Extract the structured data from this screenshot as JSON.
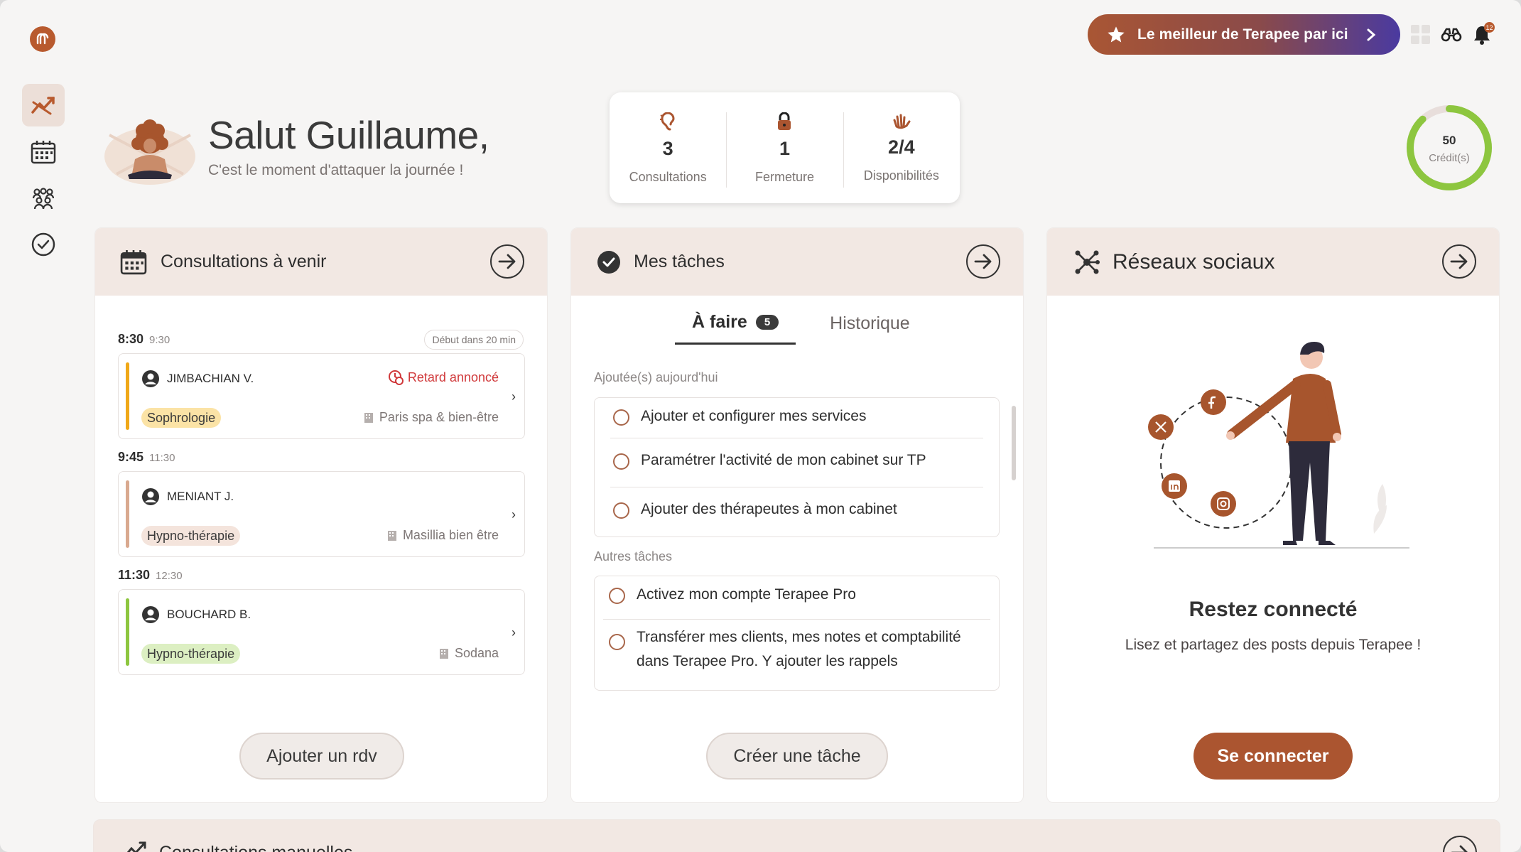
{
  "topbar": {
    "promo_label": "Le meilleur de Terapee par ici",
    "notification_count": "12",
    "icons": [
      "grid-icon",
      "binoculars-icon",
      "bell-icon"
    ]
  },
  "sidebar": {
    "items": [
      {
        "name": "dashboard",
        "icon": "chart-icon",
        "active": true
      },
      {
        "name": "calendar",
        "icon": "calendar-icon",
        "active": false
      },
      {
        "name": "clients",
        "icon": "people-icon",
        "active": false
      },
      {
        "name": "tasks",
        "icon": "check-circle-icon",
        "active": false
      }
    ]
  },
  "greeting": {
    "title": "Salut Guillaume,",
    "subtitle": "C'est le moment d'attaquer la journée !"
  },
  "stats": [
    {
      "value": "3",
      "label": "Consultations",
      "icon": "ear-icon"
    },
    {
      "value": "1",
      "label": "Fermeture",
      "icon": "lock-icon"
    },
    {
      "value": "2/4",
      "label": "Disponibilités",
      "icon": "hand-icon"
    }
  ],
  "credits": {
    "value": "50",
    "label": "Crédit(s)",
    "fraction": 0.88
  },
  "appointments_card": {
    "title": "Consultations à venir",
    "soon_badge": "Début dans 20 min",
    "button": "Ajouter un rdv",
    "items": [
      {
        "start": "8:30",
        "end": "9:30",
        "client": "JIMBACHIAN V.",
        "tag": "Sophrologie",
        "place": "Paris spa & bien-être",
        "alert": "Retard annoncé",
        "bar_color": "#f0a818",
        "tag_bg": "#fbe3a6"
      },
      {
        "start": "9:45",
        "end": "11:30",
        "client": "MENIANT J.",
        "tag": "Hypno-thérapie",
        "place": "Masillia bien être",
        "bar_color": "#d9a98f",
        "tag_bg": "#f4e4dc"
      },
      {
        "start": "11:30",
        "end": "12:30",
        "client": "BOUCHARD B.",
        "tag": "Hypno-thérapie",
        "place": "Sodana",
        "bar_color": "#8dc63f",
        "tag_bg": "#dcefc2"
      }
    ]
  },
  "tasks_card": {
    "title": "Mes tâches",
    "tab_todo": "À faire",
    "tab_todo_count": "5",
    "tab_history": "Historique",
    "group_today": "Ajoutée(s) aujourd'hui",
    "group_other": "Autres tâches",
    "today": [
      "Ajouter et configurer mes services",
      "Paramétrer l'activité de mon cabinet sur TP",
      "Ajouter des thérapeutes à mon cabinet"
    ],
    "other": [
      "Activez mon compte Terapee Pro",
      "Transférer mes clients, mes notes et comptabilité dans Terapee Pro. Y ajouter les rappels"
    ],
    "button": "Créer une tâche"
  },
  "social_card": {
    "title": "Réseaux sociaux",
    "heading": "Restez connecté",
    "text": "Lisez et partagez des posts depuis Terapee !",
    "button": "Se connecter",
    "networks": [
      "x-icon",
      "facebook-icon",
      "linkedin-icon",
      "instagram-icon"
    ]
  },
  "bottom_card": {
    "title": "Consultations manuelles"
  },
  "colors": {
    "brand": "#ab5530",
    "header_bg": "#f2e8e3",
    "credit_ring": "#8dc63f"
  }
}
